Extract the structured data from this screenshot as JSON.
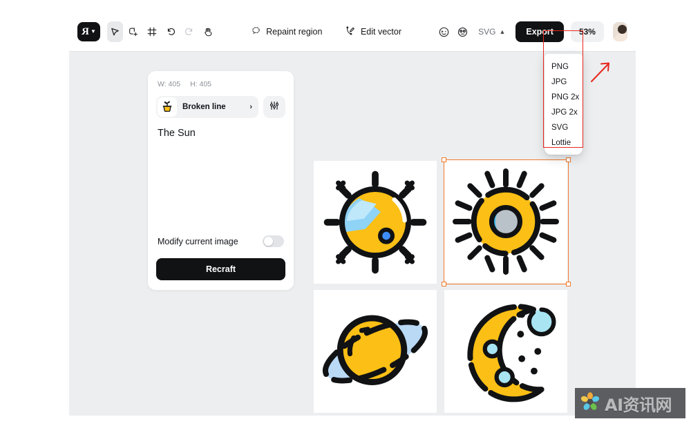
{
  "toolbar": {
    "logo_mark": "R",
    "logo_caret": "▼",
    "tools": [
      {
        "name": "select-tool",
        "icon": "cursor-icon",
        "active": true
      },
      {
        "name": "add-shape-tool",
        "icon": "add-shape-icon",
        "active": false
      },
      {
        "name": "frame-tool",
        "icon": "frame-icon",
        "active": false
      },
      {
        "name": "undo-tool",
        "icon": "undo-icon",
        "active": false
      },
      {
        "name": "redo-tool",
        "icon": "redo-icon",
        "active": false
      },
      {
        "name": "hand-tool",
        "icon": "hand-icon",
        "active": false
      }
    ],
    "repaint_region_label": "Repaint region",
    "edit_vector_label": "Edit vector",
    "face_icon_1": "winking-face-icon",
    "face_icon_2": "surprised-face-icon",
    "format_value": "SVG",
    "format_caret": "⌃",
    "export_label": "Export",
    "zoom_level": "53%"
  },
  "format_dropdown": {
    "items": [
      "PNG",
      "JPG",
      "PNG 2x",
      "JPG 2x",
      "SVG",
      "Lottie"
    ],
    "highlighted_through": "SVG"
  },
  "panel": {
    "width_label": "W: 405",
    "height_label": "H: 405",
    "style_name": "Broken line",
    "style_chevron": "›",
    "style_thumb_icon": "potted-plant-icon",
    "style_settings_icon": "sliders-icon",
    "prompt": "The Sun",
    "modify_label": "Modify current image",
    "modify_enabled": false,
    "recraft_label": "Recraft"
  },
  "gallery": {
    "tiles": [
      {
        "name": "image-tile-sun-eclipse",
        "alt": "The Sun eclipse illustration",
        "selected": false
      },
      {
        "name": "image-tile-sun-ring",
        "alt": "The Sun ring illustration",
        "selected": true
      },
      {
        "name": "image-tile-saturn",
        "alt": "Saturn planet illustration",
        "selected": false
      },
      {
        "name": "image-tile-moon",
        "alt": "Crescent moon illustration",
        "selected": false
      }
    ]
  },
  "annotation": {
    "arrow_color": "#e8261e",
    "highlight_color": "#e8261e"
  },
  "watermark": {
    "text": "AI资讯网"
  },
  "colors": {
    "accent_yellow": "#fbbf15",
    "accent_blue": "#5aaef7",
    "light_blue": "#a8e4f2",
    "selection_orange": "#f2792a",
    "dark": "#111214",
    "canvas_bg": "#eceef0"
  }
}
